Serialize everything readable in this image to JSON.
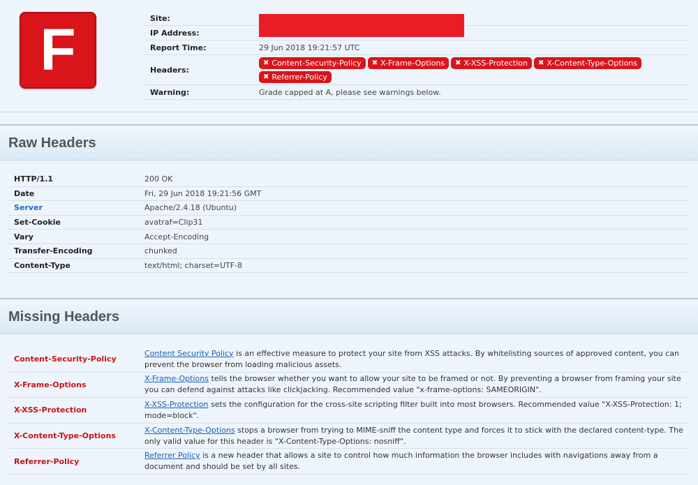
{
  "summary": {
    "grade": "F",
    "site_label": "Site:",
    "ip_label": "IP Address:",
    "report_time_label": "Report Time:",
    "report_time": "29 Jun 2018 19:21:57 UTC",
    "headers_label": "Headers:",
    "missing_badges": [
      "Content-Security-Policy",
      "X-Frame-Options",
      "X-XSS-Protection",
      "X-Content-Type-Options",
      "Referrer-Policy"
    ],
    "warning_label": "Warning:",
    "warning": "Grade capped at A, please see warnings below.",
    "colors": {
      "grade": "#d9141a",
      "redaction": "#ea1c26",
      "badge": "#d9141a"
    }
  },
  "raw_headers": {
    "title": "Raw Headers",
    "rows": [
      {
        "key": "HTTP/1.1",
        "value": "200 OK"
      },
      {
        "key": "Date",
        "value": "Fri, 29 Jun 2018 19:21:56 GMT"
      },
      {
        "key": "Server",
        "value": "Apache/2.4.18 (Ubuntu)"
      },
      {
        "key": "Set-Cookie",
        "value": "avatraf=Clip31"
      },
      {
        "key": "Vary",
        "value": "Accept-Encoding"
      },
      {
        "key": "Transfer-Encoding",
        "value": "chunked"
      },
      {
        "key": "Content-Type",
        "value": "text/html; charset=UTF-8"
      }
    ]
  },
  "missing_headers": {
    "title": "Missing Headers",
    "rows": [
      {
        "key": "Content-Security-Policy",
        "link": "Content Security Policy",
        "desc": " is an effective measure to protect your site from XSS attacks. By whitelisting sources of approved content, you can prevent the browser from loading malicious assets."
      },
      {
        "key": "X-Frame-Options",
        "link": "X-Frame-Options",
        "desc": " tells the browser whether you want to allow your site to be framed or not. By preventing a browser from framing your site you can defend against attacks like clickjacking. Recommended value \"x-frame-options: SAMEORIGIN\"."
      },
      {
        "key": "X-XSS-Protection",
        "link": "X-XSS-Protection",
        "desc": " sets the configuration for the cross-site scripting filter built into most browsers. Recommended value \"X-XSS-Protection: 1; mode=block\"."
      },
      {
        "key": "X-Content-Type-Options",
        "link": "X-Content-Type-Options",
        "desc": " stops a browser from trying to MIME-sniff the content type and forces it to stick with the declared content-type. The only valid value for this header is \"X-Content-Type-Options: nosniff\"."
      },
      {
        "key": "Referrer-Policy",
        "link": "Referrer Policy",
        "desc": " is a new header that allows a site to control how much information the browser includes with navigations away from a document and should be set by all sites."
      }
    ]
  }
}
